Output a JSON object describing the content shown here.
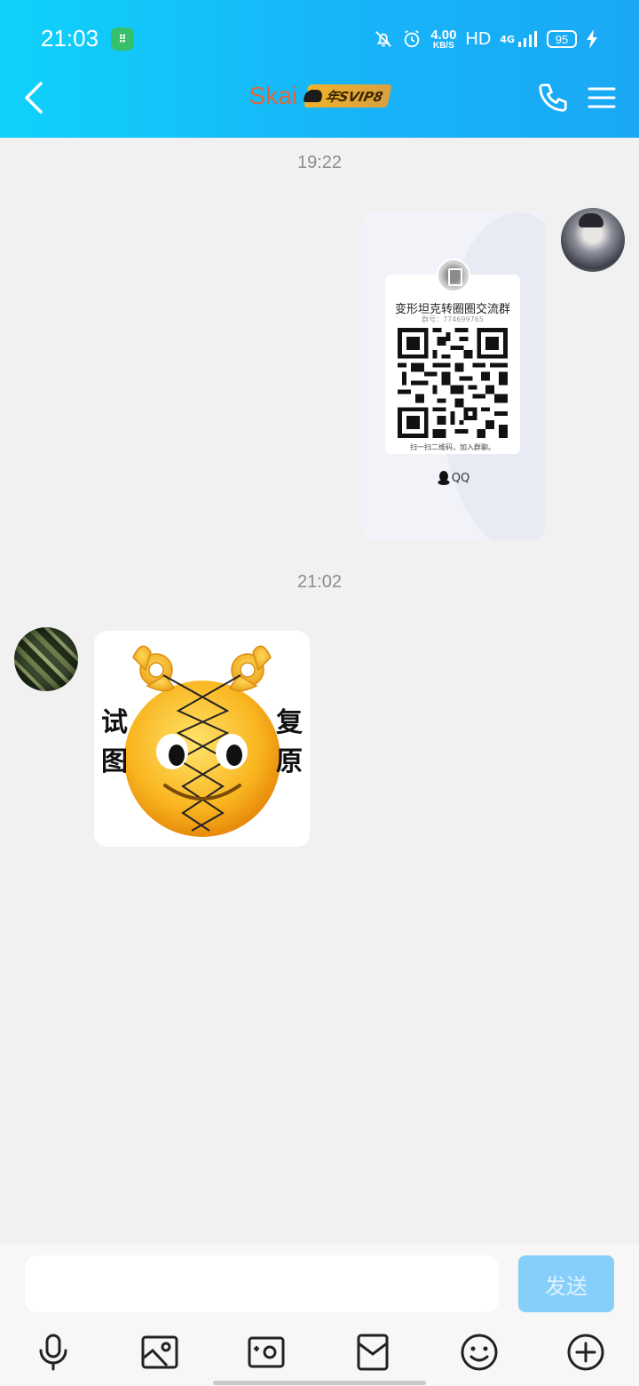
{
  "status_bar": {
    "time": "21:03",
    "net_speed_value": "4.00",
    "net_speed_unit": "KB/S",
    "hd_label": "HD",
    "network_label": "4G",
    "battery_level": "95"
  },
  "header": {
    "contact_name": "Skai",
    "vip_badge": "年SVIP8",
    "accent_color": "#1aa8f5",
    "icons": [
      "back-arrow-icon",
      "phone-icon",
      "menu-icon"
    ]
  },
  "messages": [
    {
      "timestamp": "19:22",
      "sender": "self",
      "type": "qr-card",
      "card": {
        "group_name": "变形坦克转圈圈交流群",
        "group_number": "群号：774699765",
        "footer": "扫一扫二维码，加入群聊。",
        "brand": "QQ"
      }
    },
    {
      "timestamp": "21:02",
      "sender": "other",
      "type": "sticker",
      "sticker": {
        "left_text_1": "试",
        "left_text_2": "图",
        "right_text_1": "复",
        "right_text_2": "原"
      }
    }
  ],
  "composer": {
    "input_value": "",
    "send_label": "发送",
    "tools": [
      "microphone-icon",
      "image-icon",
      "camera-icon",
      "red-packet-icon",
      "emoji-icon",
      "plus-icon"
    ]
  }
}
